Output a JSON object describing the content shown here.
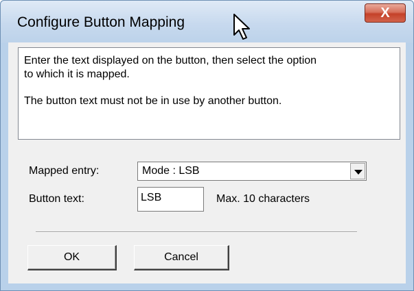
{
  "window": {
    "title": "Configure Button Mapping",
    "close_label": "X"
  },
  "info": {
    "line1": "Enter the text displayed on the button, then select the option",
    "line2": "to which it is mapped.",
    "line3": "The button text must not be in use by another button."
  },
  "form": {
    "mapped_entry_label": "Mapped entry:",
    "mapped_entry_value": "Mode : LSB",
    "button_text_label": "Button text:",
    "button_text_value": "LSB",
    "max_hint": "Max. 10 characters"
  },
  "buttons": {
    "ok": "OK",
    "cancel": "Cancel"
  }
}
